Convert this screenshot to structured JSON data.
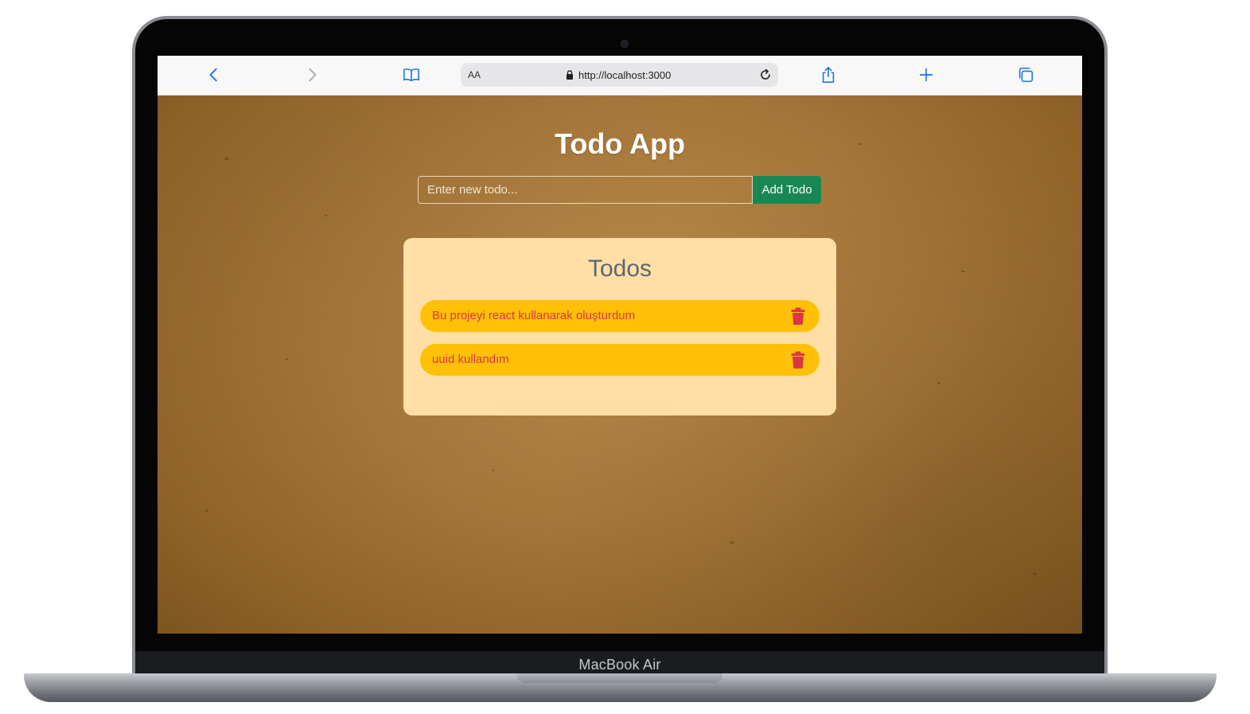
{
  "device": {
    "brand_label": "MacBook Air"
  },
  "browser": {
    "text_size_label": "AA",
    "url": "http://localhost:3000",
    "icons": {
      "back": "chevron-left-icon",
      "forward": "chevron-right-icon",
      "bookmarks": "book-icon",
      "lock": "lock-icon",
      "reload": "reload-icon",
      "share": "share-icon",
      "new_tab": "plus-icon",
      "tabs": "tabs-icon"
    },
    "accent_color": "#1a73e8"
  },
  "app": {
    "title": "Todo App",
    "input": {
      "value": "",
      "placeholder": "Enter new todo..."
    },
    "add_button_label": "Add Todo",
    "colors": {
      "add_button": "#198754",
      "card_bg": "#ffdfa6",
      "item_bg": "#ffc107",
      "item_text": "#dc3545"
    }
  },
  "todos": {
    "heading": "Todos",
    "items": [
      {
        "text": "Bu projeyi react kullanarak oluşturdum",
        "icon": "trash-icon"
      },
      {
        "text": "uuid kullandım",
        "icon": "trash-icon"
      }
    ]
  }
}
